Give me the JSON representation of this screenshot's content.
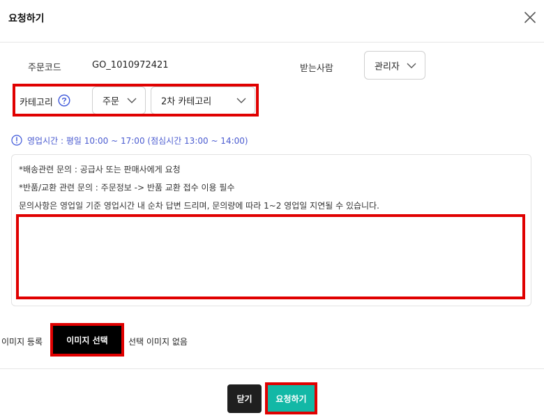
{
  "modal": {
    "title": "요청하기"
  },
  "order": {
    "code_label": "주문코드",
    "code_value": "GO_1010972421",
    "receiver_label": "받는사람",
    "receiver_value": "관리자"
  },
  "category": {
    "label": "카테고리",
    "primary_value": "주문",
    "secondary_value": "2차 카테고리"
  },
  "notice": {
    "business_hours": "영업시간 : 평일 10:00 ~ 17:00 (점심시간 13:00 ~ 14:00)",
    "lines": [
      "*배송관련 문의 : 공급사 또는 판매사에게 요청",
      "*반품/교환 관련 문의 : 주문정보 -> 반품 교환 접수 이용 필수",
      "문의사항은 영업일 기준 영업시간 내 순차 답변 드리며, 문의량에 따라 1~2 영업일 지연될 수 있습니다."
    ],
    "content_value": ""
  },
  "image": {
    "label": "이미지 등록",
    "select_button": "이미지 선택",
    "status": "선택 이미지 없음"
  },
  "footer": {
    "close_label": "닫기",
    "submit_label": "요청하기"
  },
  "colors": {
    "highlight": "#e00000",
    "submit": "#13b8a6",
    "notice_text": "#4a5bd0"
  },
  "icons": {
    "close": "close-icon",
    "help": "help-circle-icon",
    "info": "info-circle-icon",
    "dropdown": "chevron-down-icon"
  }
}
